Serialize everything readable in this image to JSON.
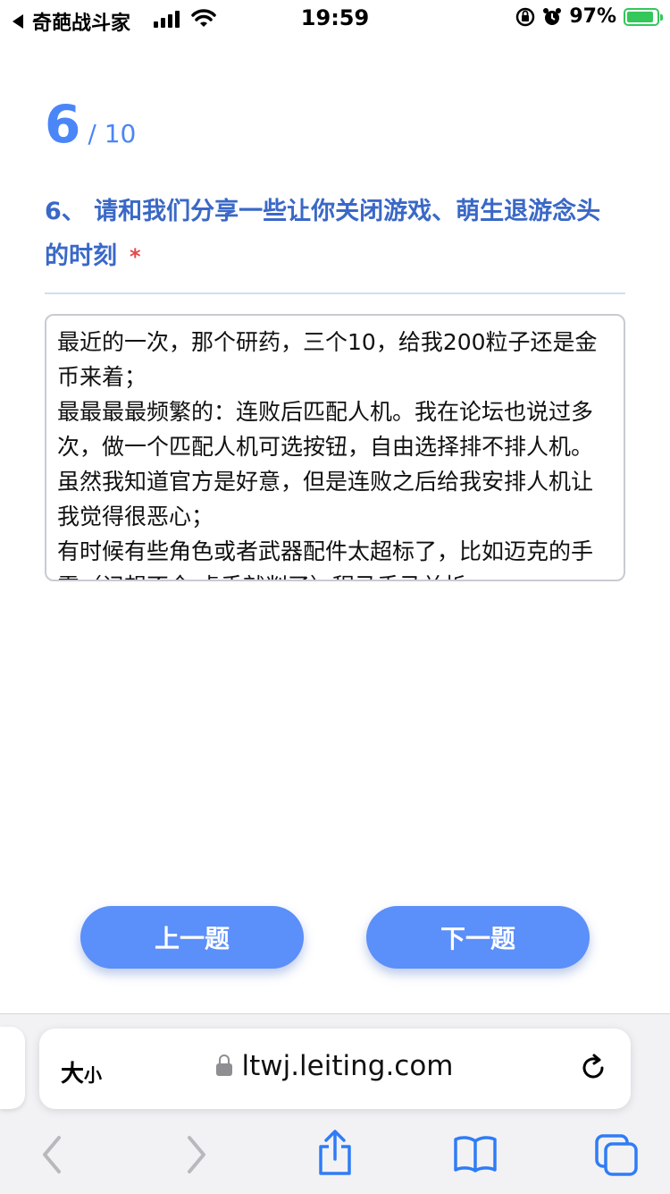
{
  "status_bar": {
    "back_app": "奇葩战斗家",
    "time": "19:59",
    "battery": "97%"
  },
  "progress": {
    "current": "6",
    "total": "/ 10"
  },
  "question": {
    "text": "6、 请和我们分享一些让你关闭游戏、萌生退游念头的时刻",
    "required_mark": "*"
  },
  "answer": {
    "value": "最近的一次，那个研药，三个10，给我200粒子还是金币来着；\n最最最最频繁的：连败后匹配人机。我在论坛也说过多次，做一个匹配人机可选按钮，自由选择排不排人机。虽然我知道官方是好意，但是连败之后给我安排人机让我觉得很恶心；\n有时候有些角色或者武器配件太超标了，比如迈克的手雷（记想不全 虎手就判了）程马手马关析"
  },
  "buttons": {
    "prev": "上一题",
    "next": "下一题"
  },
  "browser": {
    "text_size": "大",
    "text_size_small": "小",
    "url": "ltwj.leiting.com"
  },
  "colors": {
    "accent": "#5b8ff9",
    "question": "#3a68c7",
    "required": "#e54848"
  },
  "icons": [
    "back-arrow-icon",
    "signal-icon",
    "wifi-icon",
    "orientation-lock-icon",
    "alarm-icon",
    "battery-icon",
    "lock-icon",
    "reload-icon",
    "chevron-left-icon",
    "chevron-right-icon",
    "share-icon",
    "bookmarks-icon",
    "tabs-icon"
  ]
}
